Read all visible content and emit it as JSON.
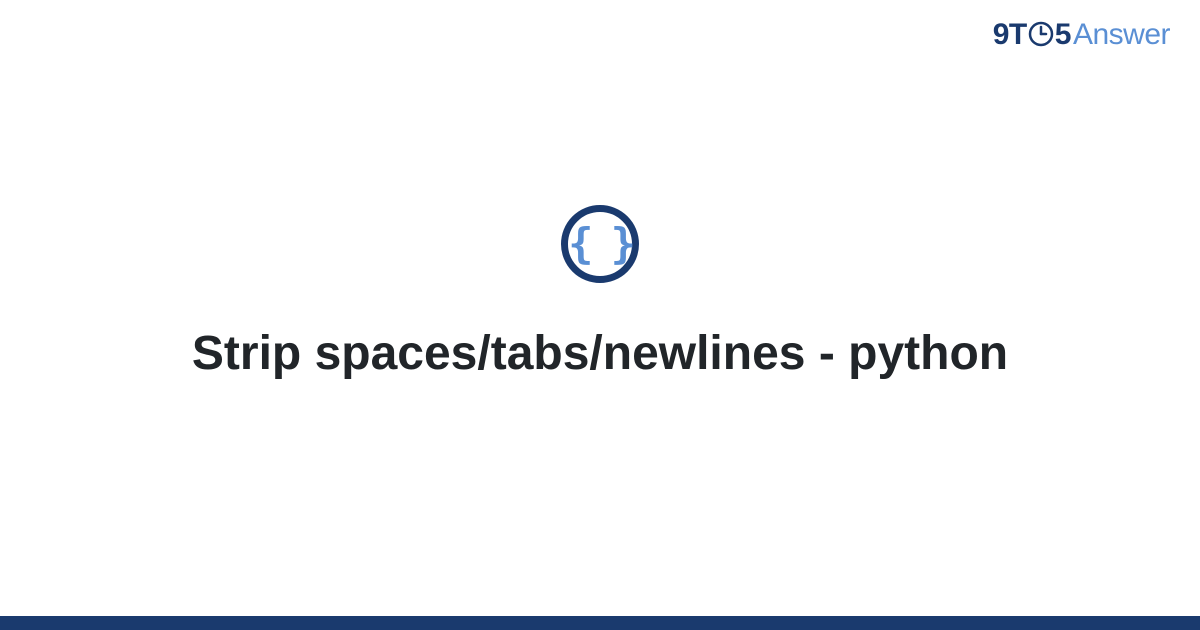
{
  "brand": {
    "part1": "9T",
    "part2": "5",
    "part3": "Answer"
  },
  "icon": {
    "symbol": "{ }"
  },
  "main": {
    "title": "Strip spaces/tabs/newlines - python"
  },
  "colors": {
    "dark_blue": "#1a3a6e",
    "light_blue": "#5a8fd4",
    "text": "#212529"
  }
}
